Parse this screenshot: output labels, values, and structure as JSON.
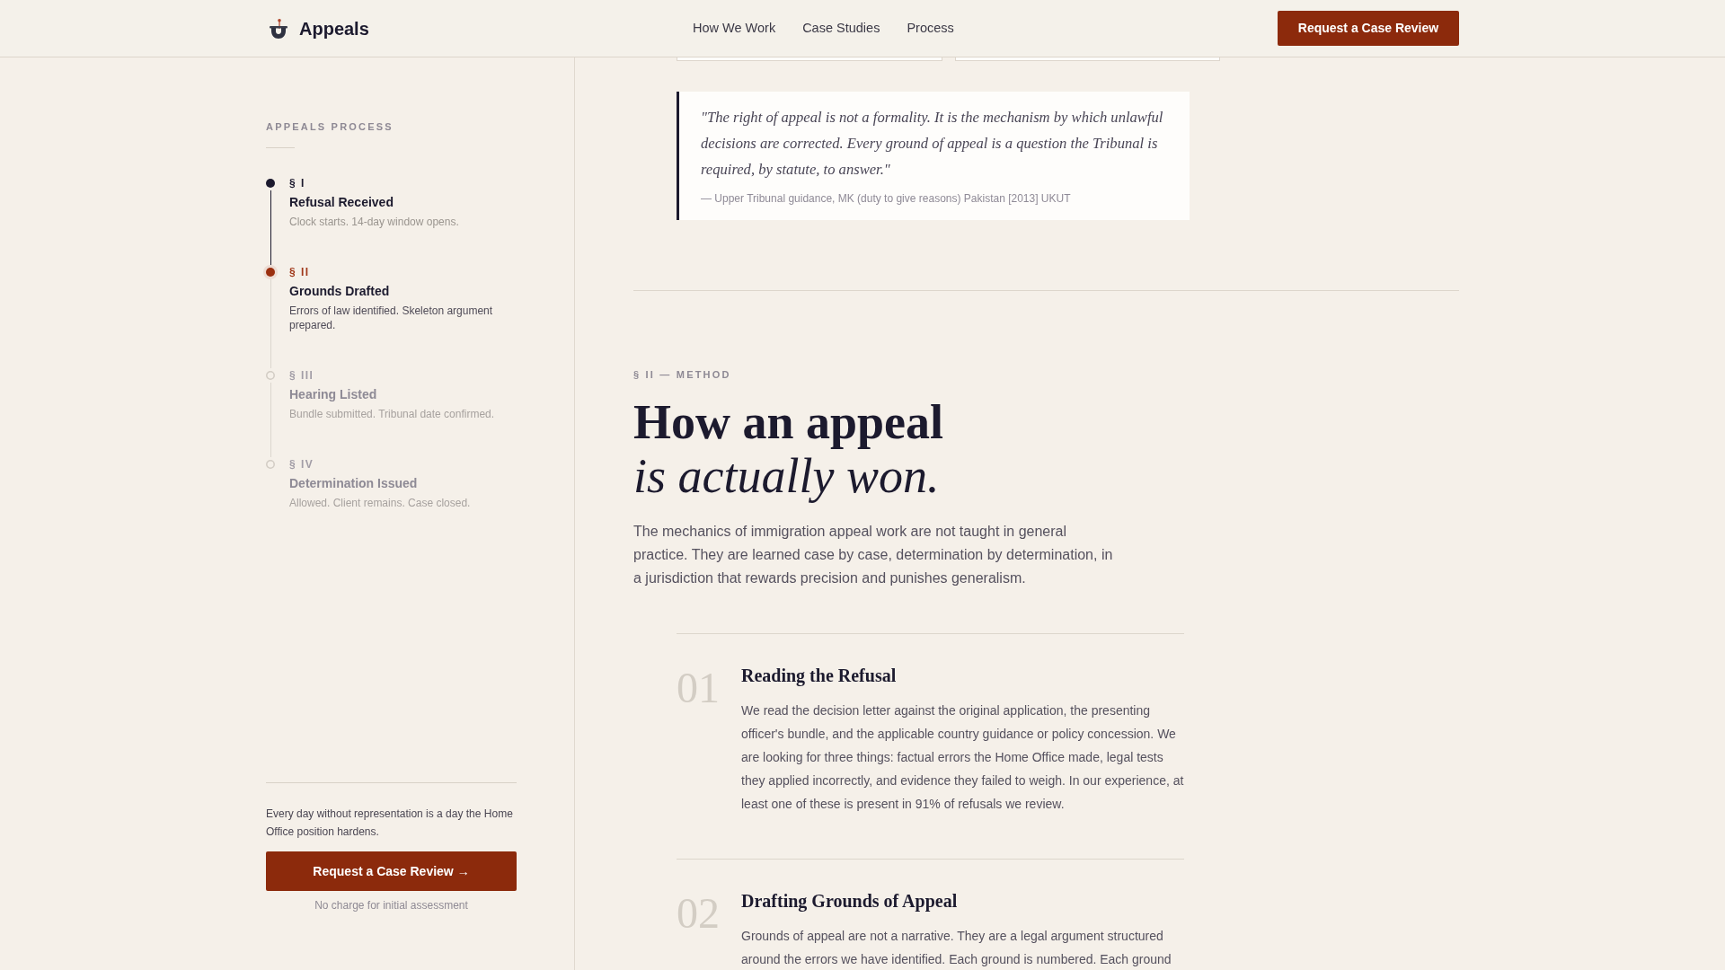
{
  "header": {
    "brand": "Appeals",
    "nav": [
      "How We Work",
      "Case Studies",
      "Process"
    ],
    "cta": "Request a Case Review"
  },
  "sidebar": {
    "title": "APPEALS PROCESS",
    "steps": [
      {
        "number": "§ I",
        "title": "Refusal Received",
        "description": "Clock starts. 14-day window opens.",
        "completed": true,
        "selected": false
      },
      {
        "number": "§ II",
        "title": "Grounds Drafted",
        "description": "Errors of law identified. Skeleton argument prepared.",
        "completed": false,
        "selected": true
      },
      {
        "number": "§ III",
        "title": "Hearing Listed",
        "description": "Bundle submitted. Tribunal date confirmed.",
        "completed": false,
        "selected": false
      },
      {
        "number": "§ IV",
        "title": "Determination Issued",
        "description": "Allowed. Client remains. Case closed.",
        "completed": false,
        "selected": false
      }
    ],
    "note": "Every day without representation is a day the Home Office position hardens.",
    "cta": "Request a Case Review →",
    "cta_note": "No charge for initial assessment"
  },
  "main": {
    "quote": {
      "text": "\"The right of appeal is not a formality. It is the mechanism by which unlawful decisions are corrected. Every ground of appeal is a question the Tribunal is required, by statute, to answer.\"",
      "citation": "— Upper Tribunal guidance, MK (duty to give reasons) Pakistan [2013] UKUT"
    },
    "section": {
      "eyebrow": "§ II — METHOD",
      "heading": "How an appeal",
      "heading_emphasis": "is actually won.",
      "intro": "The mechanics of immigration appeal work are not taught in general practice. They are learned case by case, determination by determination, in a jurisdiction that rewards precision and punishes generalism.",
      "items": [
        {
          "number": "01",
          "title": "Reading the Refusal",
          "body": "We read the decision letter against the original application, the presenting officer's bundle, and the applicable country guidance or policy concession. We are looking for three things: factual errors the Home Office made, legal tests they applied incorrectly, and evidence they failed to weigh. In our experience, at least one of these is present in 91% of refusals we review."
        },
        {
          "number": "02",
          "title": "Drafting Grounds of Appeal",
          "body": "Grounds of appeal are not a narrative. They are a legal argument structured around the errors we have identified. Each ground is numbered. Each ground"
        }
      ]
    }
  }
}
